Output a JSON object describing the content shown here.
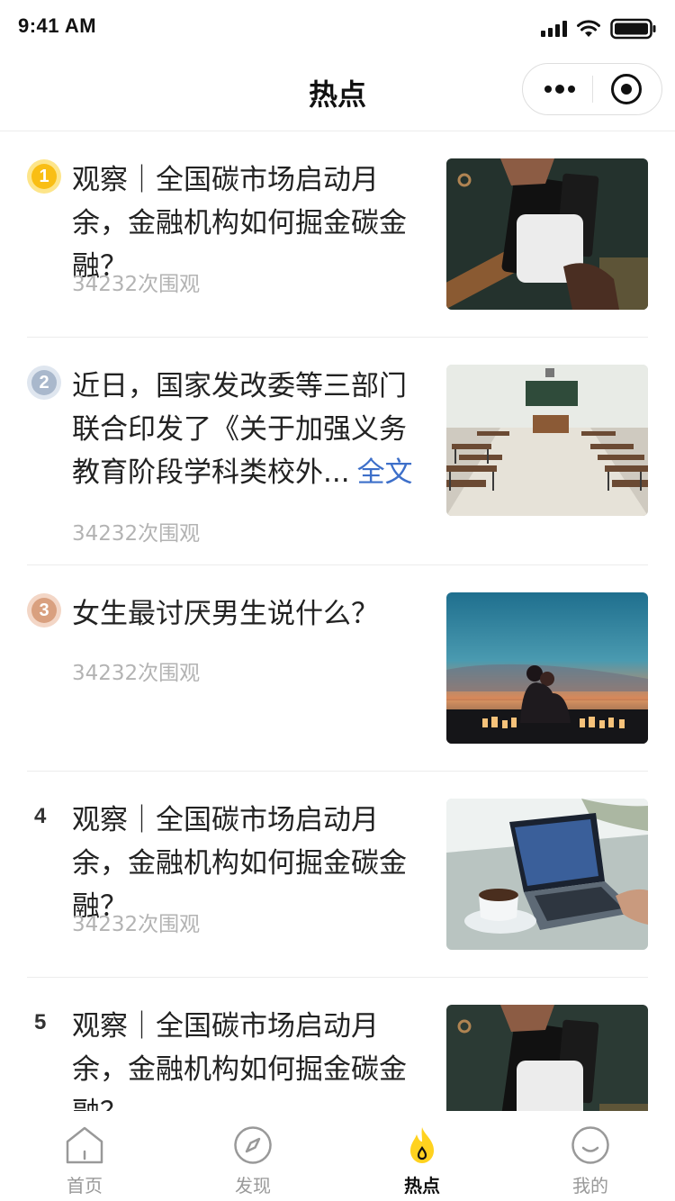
{
  "status_bar": {
    "time": "9:41 AM",
    "icons": [
      "cellular-signal-icon",
      "wifi-icon",
      "battery-icon"
    ]
  },
  "nav": {
    "title": "热点",
    "capsule_icons": [
      "more-dots-icon",
      "close-target-icon"
    ]
  },
  "items": [
    {
      "rank": "1",
      "rank_style": "gold-medal",
      "title": "观察｜全国碳市场启动月余，金融机构如何掘金碳金融？",
      "views": "34232次围观",
      "image": "card-payment-photo"
    },
    {
      "rank": "2",
      "rank_style": "silver-medal",
      "title": "近日，国家发改委等三部门联合印发了《关于加强义务教育阶段学科类校外...",
      "more_link": "全文",
      "views": "34232次围观",
      "image": "empty-classroom-photo"
    },
    {
      "rank": "3",
      "rank_style": "bronze-medal",
      "title": "女生最讨厌男生说什么？",
      "views": "34232次围观",
      "image": "couple-sunset-photo"
    },
    {
      "rank": "4",
      "rank_style": "plain",
      "title": "观察｜全国碳市场启动月余，金融机构如何掘金碳金融？",
      "views": "34232次围观",
      "image": "laptop-coffee-photo"
    },
    {
      "rank": "5",
      "rank_style": "plain",
      "title": "观察｜全国碳市场启动月余，金融机构如何掘金碳金融？",
      "views": "",
      "image": "card-payment-photo"
    }
  ],
  "tabs": [
    {
      "label": "首页",
      "icon": "home-icon",
      "active": false
    },
    {
      "label": "发现",
      "icon": "compass-icon",
      "active": false
    },
    {
      "label": "热点",
      "icon": "flame-icon",
      "active": true
    },
    {
      "label": "我的",
      "icon": "smiley-profile-icon",
      "active": false
    }
  ],
  "colors": {
    "link_blue": "#3d6fc9",
    "gold_medal": "#f9be14",
    "silver_medal": "#a9b8cc",
    "bronze_medal": "#d9a07f",
    "flame_yellow": "#ffd21f",
    "muted_text": "#b3b3b3"
  }
}
